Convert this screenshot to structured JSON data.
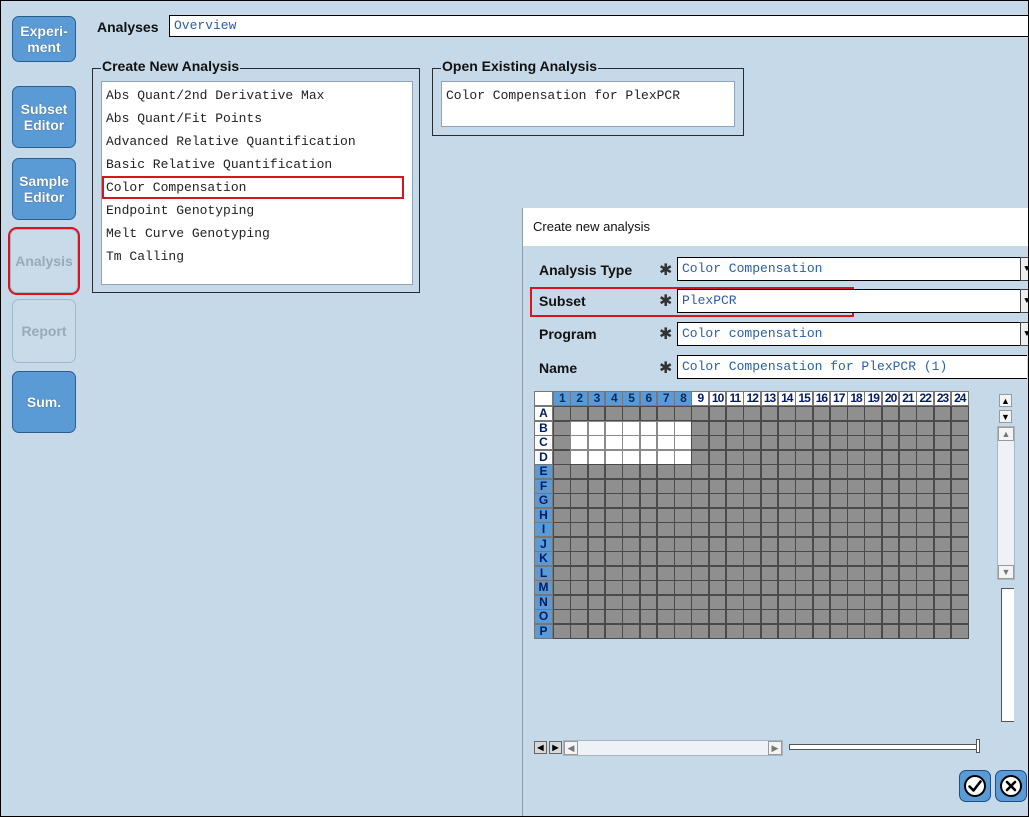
{
  "sidebar": {
    "experiment": [
      "Experi-",
      "ment"
    ],
    "subset_editor": [
      "Subset",
      "Editor"
    ],
    "sample_editor": [
      "Sample",
      "Editor"
    ],
    "analysis": "Analysis",
    "report": "Report",
    "sum": "Sum."
  },
  "top": {
    "label": "Analyses",
    "value": "Overview"
  },
  "create_group": {
    "title": "Create New Analysis",
    "items": [
      "Abs Quant/2nd Derivative Max",
      "Abs Quant/Fit Points",
      "Advanced Relative Quantification",
      "Basic Relative Quantification",
      "Color Compensation",
      "Endpoint Genotyping",
      "Melt Curve Genotyping",
      "Tm Calling"
    ],
    "selected": "Color Compensation"
  },
  "open_group": {
    "title": "Open Existing Analysis",
    "items": [
      "Color Compensation for PlexPCR"
    ]
  },
  "dialog": {
    "title": "Create new analysis",
    "required_mark": "✱",
    "analysis_type": {
      "label": "Analysis Type",
      "value": "Color Compensation"
    },
    "subset": {
      "label": "Subset",
      "value": "PlexPCR"
    },
    "program": {
      "label": "Program",
      "value": "Color compensation"
    },
    "name": {
      "label": "Name",
      "value": "Color Compensation for PlexPCR (1)"
    }
  },
  "plate": {
    "columns": [
      "1",
      "2",
      "3",
      "4",
      "5",
      "6",
      "7",
      "8",
      "9",
      "10",
      "11",
      "12",
      "13",
      "14",
      "15",
      "16",
      "17",
      "18",
      "19",
      "20",
      "21",
      "22",
      "23",
      "24"
    ],
    "rows": [
      "A",
      "B",
      "C",
      "D",
      "E",
      "F",
      "G",
      "H",
      "I",
      "J",
      "K",
      "L",
      "M",
      "N",
      "O",
      "P"
    ],
    "selected_columns": [
      "1",
      "2",
      "3",
      "4",
      "5",
      "6",
      "7",
      "8"
    ],
    "selected_rows": [
      "A",
      "B",
      "C",
      "D"
    ],
    "active_wells": [
      "B2",
      "B3",
      "B4",
      "B5",
      "B6",
      "B7",
      "B8",
      "C2",
      "C3",
      "C4",
      "C5",
      "C6",
      "C7",
      "C8",
      "D2",
      "D3",
      "D4",
      "D5",
      "D6",
      "D7",
      "D8"
    ]
  },
  "buttons": {
    "ok": "ok-check-icon",
    "cancel": "cancel-x-icon"
  }
}
